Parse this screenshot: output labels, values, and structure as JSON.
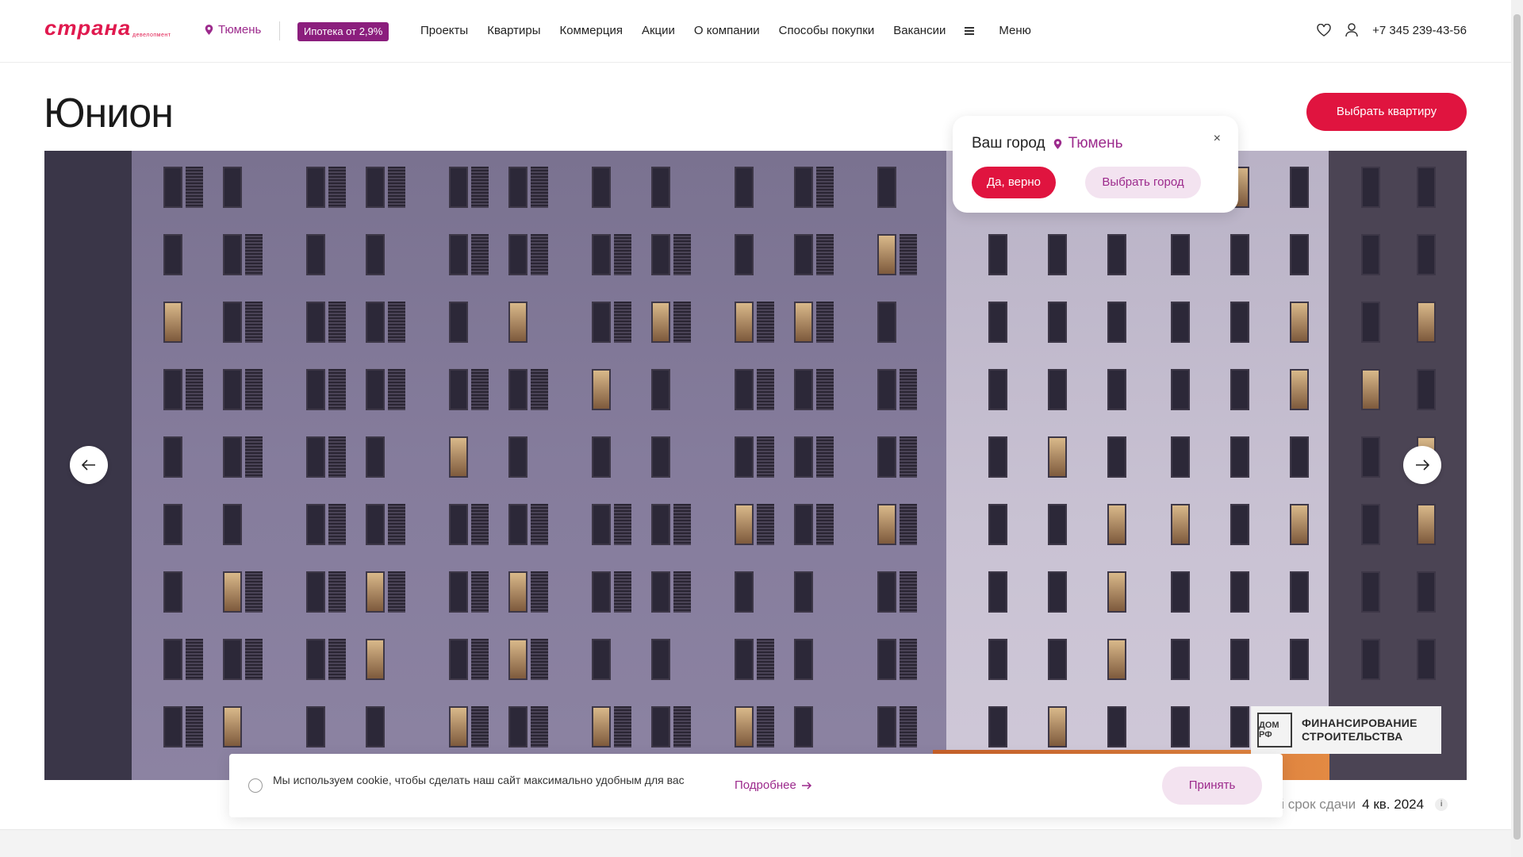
{
  "header": {
    "logo": "страна",
    "logo_sub": "девелопмент",
    "city": "Тюмень",
    "promo": "Ипотека от 2,9%",
    "nav": [
      "Проекты",
      "Квартиры",
      "Коммерция",
      "Акции",
      "О компании",
      "Способы покупки",
      "Вакансии"
    ],
    "menu_label": "Меню",
    "phone": "+7 345 239-43-56",
    "icons": [
      "map-pin-icon",
      "menu-icon",
      "heart-icon",
      "user-icon"
    ]
  },
  "page": {
    "title": "Юнион",
    "choose_button": "Выбрать квартиру"
  },
  "city_popup": {
    "label": "Ваш город",
    "city": "Тюмень",
    "close": "×",
    "yes_button": "Да, верно",
    "choose_button": "Выбрать город"
  },
  "hero": {
    "domrf_logo": "ДОМ РФ",
    "domrf_text": "ФИНАНСИРОВАНИЕ СТРОИТЕЛЬСТВА"
  },
  "cookie": {
    "text": "Мы используем cookie, чтобы сделать наш сайт максимально удобным для вас",
    "more": "Подробнее",
    "accept": "Принять"
  },
  "deadline": {
    "label": "ий срок сдачи",
    "value": "4 кв. 2024",
    "info": "i"
  },
  "colors": {
    "accent_red": "#e0143f",
    "brand_purple": "#9c2a8c",
    "promo_bg": "#8b1e7d"
  }
}
